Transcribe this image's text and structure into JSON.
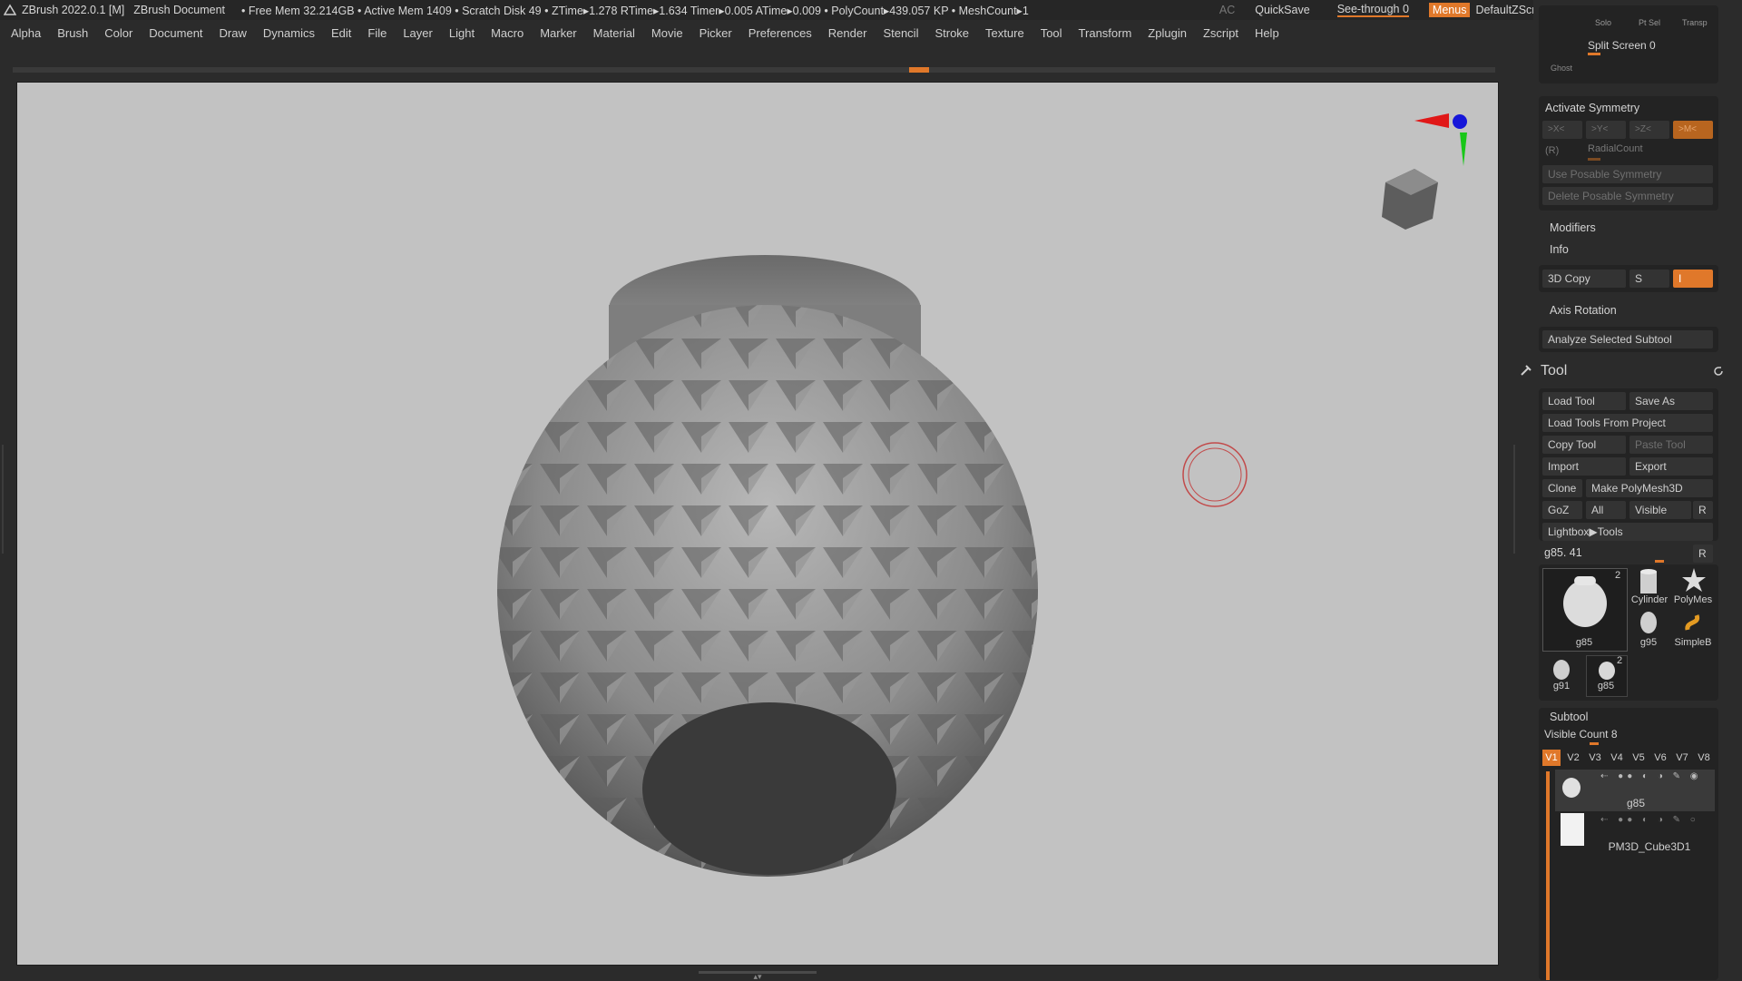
{
  "titlebar": {
    "app_title": "ZBrush 2022.0.1 [M]",
    "document": "ZBrush Document",
    "stats": "• Free Mem 32.214GB • Active Mem 1409 • Scratch Disk 49 •  ZTime▸1.278 RTime▸1.634 Timer▸0.005 ATime▸0.009 • PolyCount▸439.057 KP • MeshCount▸1",
    "ac": "AC",
    "quicksave": "QuickSave",
    "see_through": "See-through  0",
    "menus": "Menus",
    "script": "DefaultZScript"
  },
  "menubar": [
    "Alpha",
    "Brush",
    "Color",
    "Document",
    "Draw",
    "Dynamics",
    "Edit",
    "File",
    "Layer",
    "Light",
    "Macro",
    "Marker",
    "Material",
    "Movie",
    "Picker",
    "Preferences",
    "Render",
    "Stencil",
    "Stroke",
    "Texture",
    "Tool",
    "Transform",
    "Zplugin",
    "Zscript",
    "Help"
  ],
  "panel": {
    "solo": "Solo",
    "ptsel": "Pt Sel",
    "transp": "Transp",
    "ghost": "Ghost",
    "split_screen": "Split Screen 0",
    "activate_symmetry": "Activate Symmetry",
    "sym_x": ">X<",
    "sym_y": ">Y<",
    "sym_z": ">Z<",
    "sym_m": ">M<",
    "sym_r": "(R)",
    "radial_count": "RadialCount",
    "use_posable": "Use Posable Symmetry",
    "delete_posable": "Delete Posable Symmetry",
    "modifiers": "Modifiers",
    "info": "Info",
    "copy3d": "3D Copy",
    "copy_s": "S",
    "copy_i": "I",
    "axis_rotation": "Axis Rotation",
    "analyze": "Analyze Selected Subtool"
  },
  "tool": {
    "title": "Tool",
    "load_tool": "Load Tool",
    "save_as": "Save As",
    "load_from_project": "Load Tools From Project",
    "copy_tool": "Copy Tool",
    "paste_tool": "Paste Tool",
    "import": "Import",
    "export": "Export",
    "clone": "Clone",
    "make_polymesh": "Make PolyMesh3D",
    "goz": "GoZ",
    "all": "All",
    "visible": "Visible",
    "r": "R",
    "lightbox": "Lightbox▶Tools",
    "current_tool": "g85. 41",
    "thumbs": {
      "main": "g85",
      "main_count": "2",
      "cylinder": "Cylinder",
      "polymesh": "PolyMes",
      "g95": "g95",
      "simpleb": "SimpleB",
      "g91": "g91",
      "g85b": "g85",
      "g85b_count": "2"
    }
  },
  "subtool": {
    "title": "Subtool",
    "visible_count": "Visible Count 8",
    "tabs": [
      "V1",
      "V2",
      "V3",
      "V4",
      "V5",
      "V6",
      "V7",
      "V8"
    ],
    "items": [
      "g85",
      "PM3D_Cube3D1"
    ]
  },
  "colors": {
    "accent": "#e0782a",
    "viewport_bg": "#c2c2c2",
    "ui_bg": "#2b2b2b"
  }
}
